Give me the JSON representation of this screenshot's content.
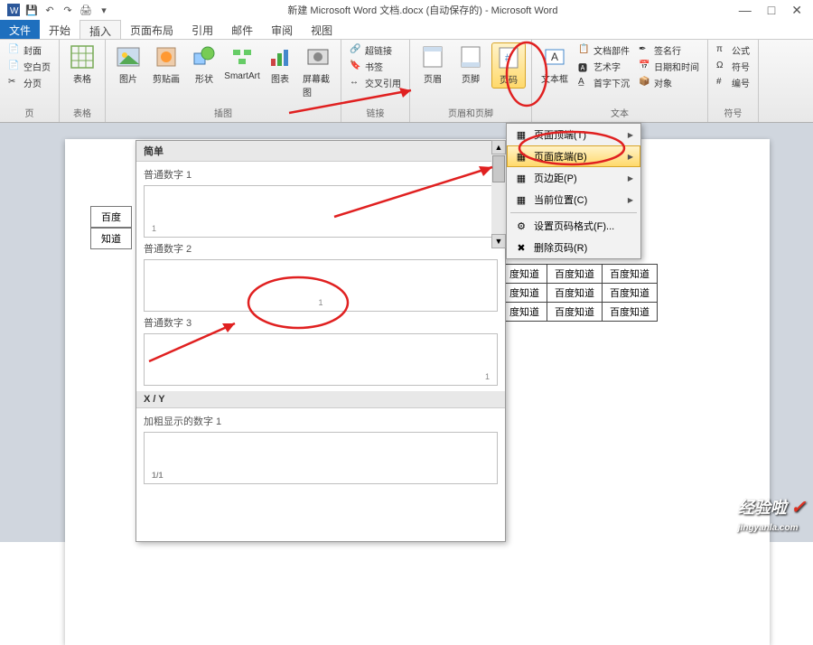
{
  "title": "新建 Microsoft Word 文档.docx (自动保存的) - Microsoft Word",
  "win_controls": {
    "min": "—",
    "max": "□",
    "close": "✕"
  },
  "tabs": {
    "file": "文件",
    "home": "开始",
    "insert": "插入",
    "layout": "页面布局",
    "ref": "引用",
    "mail": "邮件",
    "review": "审阅",
    "view": "视图"
  },
  "ribbon": {
    "pages": {
      "cover": "封面",
      "blank": "空白页",
      "break": "分页",
      "label": "页"
    },
    "tables": {
      "table": "表格",
      "label": "表格"
    },
    "illust": {
      "picture": "图片",
      "clipart": "剪贴画",
      "shapes": "形状",
      "smartart": "SmartArt",
      "chart": "图表",
      "screenshot": "屏幕截图",
      "label": "插图"
    },
    "links": {
      "hyper": "超链接",
      "bookmark": "书签",
      "crossref": "交叉引用",
      "label": "链接"
    },
    "hf": {
      "header": "页眉",
      "footer": "页脚",
      "pagenum": "页码",
      "label": "页眉和页脚"
    },
    "text": {
      "textbox": "文本框",
      "parts": "文档部件",
      "wordart": "艺术字",
      "dropcap": "首字下沉",
      "sig": "签名行",
      "datetime": "日期和时间",
      "obj": "对象",
      "label": "文本"
    },
    "sym": {
      "eq": "公式",
      "sym": "符号",
      "num": "编号",
      "label": "符号"
    }
  },
  "dropdown": {
    "top": "页面顶端(T)",
    "bottom": "页面底端(B)",
    "margins": "页边距(P)",
    "current": "当前位置(C)",
    "format": "设置页码格式(F)...",
    "remove": "删除页码(R)"
  },
  "gallery": {
    "header": "简单",
    "item1": "普通数字 1",
    "item2": "普通数字 2",
    "item3": "普通数字 3",
    "section2": "X / Y",
    "item4": "加粗显示的数字 1",
    "pn": "1",
    "pnxy": "1/1"
  },
  "side": {
    "a": "百度",
    "b": "知道"
  },
  "table_cell": "百度知道",
  "table_cell_partial": "度知道",
  "watermark": {
    "text": "经验啦",
    "url": "jingyanla.com"
  }
}
